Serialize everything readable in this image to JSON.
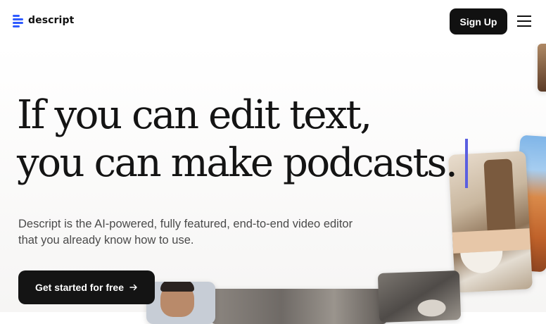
{
  "header": {
    "logo_text": "descript",
    "signup_label": "Sign Up"
  },
  "hero": {
    "headline_line1": "If you can edit text,",
    "headline_line2": "you can make podcasts.",
    "subtitle_line1": "Descript is the AI-powered, fully featured, end-to-end video editor",
    "subtitle_line2": "that you already know how to use.",
    "cta_label": "Get started for free"
  },
  "colors": {
    "brand_blue": "#2f5bff",
    "cursor_purple": "#5a5fe0",
    "button_dark": "#111111"
  },
  "icons": [
    "descript-logo-icon",
    "hamburger-menu-icon",
    "arrow-right-icon"
  ]
}
